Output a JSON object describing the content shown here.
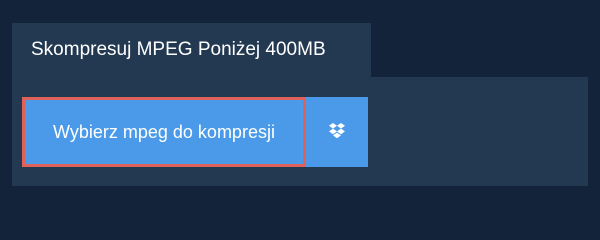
{
  "tab": {
    "title": "Skompresuj MPEG Poniżej 400MB"
  },
  "upload": {
    "button_label": "Wybierz mpeg do kompresji"
  },
  "dropbox": {
    "icon": "dropbox-icon"
  },
  "colors": {
    "background": "#13233a",
    "panel": "#223951",
    "button": "#4a9ae9",
    "button_border_highlight": "#e0605a",
    "text": "#ffffff"
  }
}
